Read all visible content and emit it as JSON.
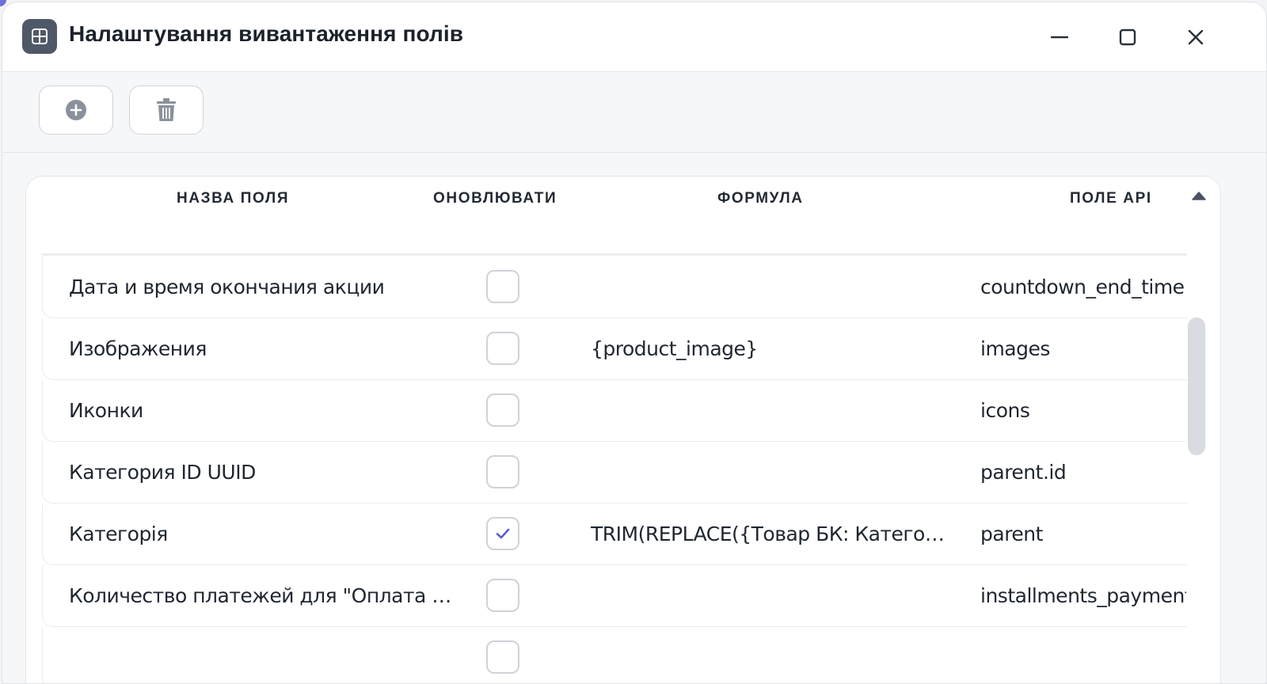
{
  "window": {
    "title": "Налаштування вивантаження полів"
  },
  "toolbar": {
    "add_icon": "plus-circle-icon",
    "delete_icon": "trash-icon"
  },
  "table": {
    "headers": {
      "name": "НАЗВА ПОЛЯ",
      "update": "ОНОВЛЮВАТИ",
      "formula": "ФОРМУЛА",
      "api": "ПОЛЕ API"
    },
    "rows": [
      {
        "name": "Дата и время окончания акции",
        "update": false,
        "formula": "",
        "api": "countdown_end_time"
      },
      {
        "name": "Изображения",
        "update": false,
        "formula": "{product_image}",
        "api": "images"
      },
      {
        "name": "Иконки",
        "update": false,
        "formula": "",
        "api": "icons"
      },
      {
        "name": "Категория ID UUID",
        "update": false,
        "formula": "",
        "api": "parent.id"
      },
      {
        "name": "Категорія",
        "update": true,
        "formula": "TRIM(REPLACE({Товар БК: Категорія}, \"...",
        "api": "parent"
      },
      {
        "name": "Количество платежей для \"Оплата час...",
        "update": false,
        "formula": "",
        "api": "installments_payment"
      },
      {
        "name": "",
        "update": false,
        "formula": "",
        "api": ""
      }
    ]
  },
  "colors": {
    "accent": "#5a5fd0",
    "border": "#cfd3d8",
    "app_icon_bg": "#4f5866"
  }
}
